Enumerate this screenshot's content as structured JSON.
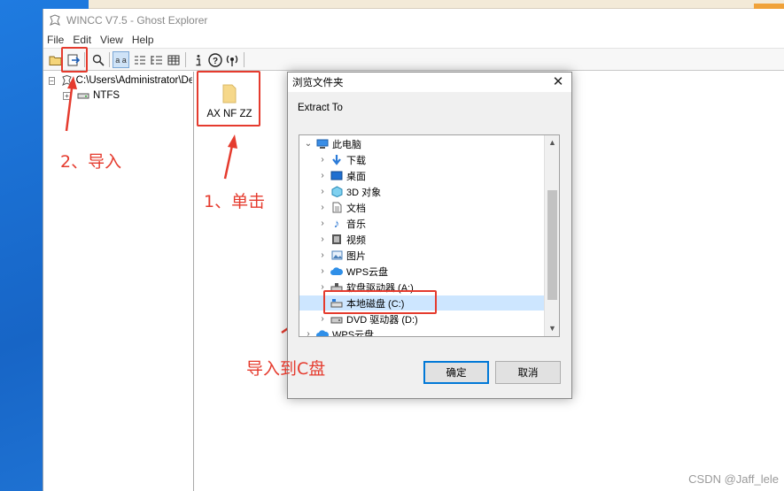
{
  "desktop": {
    "accent": "#1a6fd0"
  },
  "window": {
    "title": "WINCC V7.5 - Ghost Explorer",
    "menu": [
      "File",
      "Edit",
      "View",
      "Help"
    ]
  },
  "toolbar": {
    "icons": [
      "open-folder-icon",
      "import-icon",
      "search-icon",
      "large-icons-icon",
      "small-icons-icon",
      "list-view-icon",
      "details-view-icon",
      "info-icon",
      "help-icon",
      "broadcast-icon"
    ]
  },
  "tree": {
    "root_path": "C:\\Users\\Administrator\\De",
    "child": "NTFS"
  },
  "file_list": {
    "items": [
      {
        "name": "AX NF ZZ"
      }
    ]
  },
  "annotations": {
    "step1": "1、单击",
    "step2": "2、导入",
    "target": "导入到C盘",
    "color": "#e53b2e"
  },
  "dialog": {
    "title": "浏览文件夹",
    "subtitle": "Extract To",
    "items": [
      {
        "label": "此电脑",
        "expanded": true
      },
      {
        "label": "下载"
      },
      {
        "label": "桌面"
      },
      {
        "label": "3D 对象"
      },
      {
        "label": "文档"
      },
      {
        "label": "音乐"
      },
      {
        "label": "视频"
      },
      {
        "label": "图片"
      },
      {
        "label": "WPS云盘"
      },
      {
        "label": "软盘驱动器 (A:)"
      },
      {
        "label": "本地磁盘 (C:)",
        "selected": true
      },
      {
        "label": "DVD 驱动器 (D:)"
      },
      {
        "label": "WPS云盘"
      }
    ],
    "ok_label": "确定",
    "cancel_label": "取消"
  },
  "watermark": "CSDN @Jaff_lele"
}
